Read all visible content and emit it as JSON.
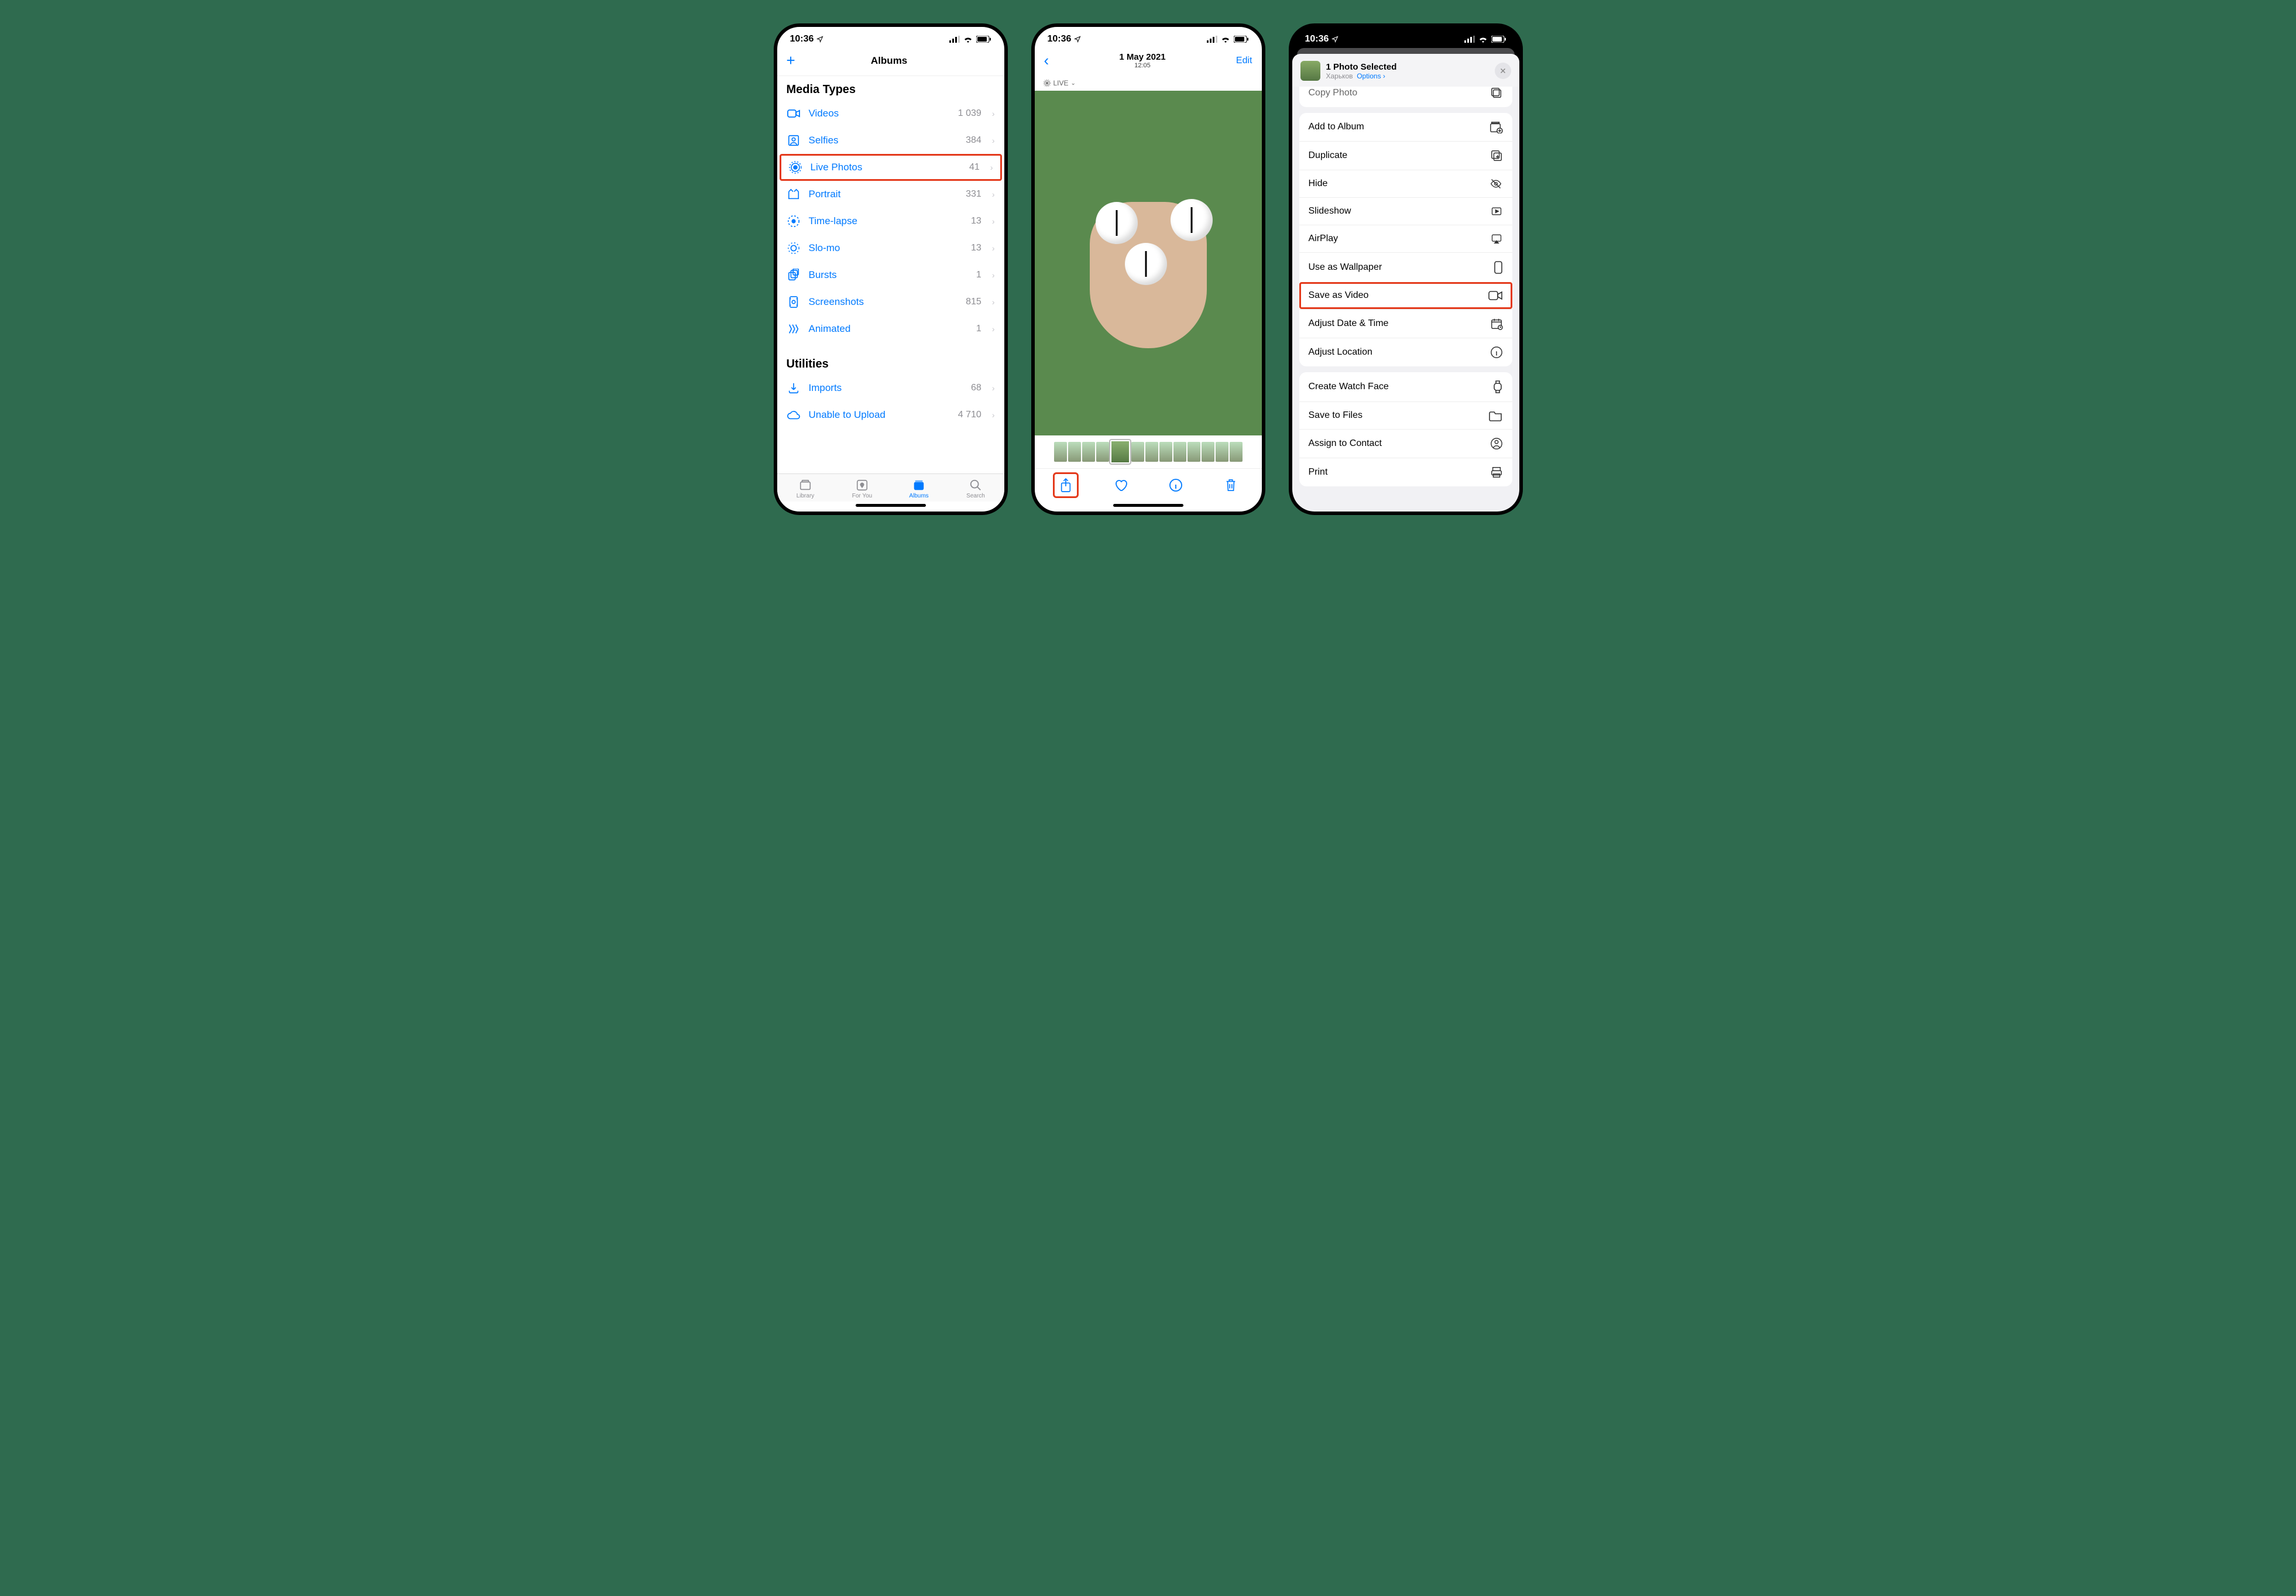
{
  "status": {
    "time": "10:36"
  },
  "screen1": {
    "nav_title": "Albums",
    "sections": {
      "media_types": {
        "title": "Media Types",
        "items": [
          {
            "label": "Videos",
            "count": "1 039",
            "icon": "video"
          },
          {
            "label": "Selfies",
            "count": "384",
            "icon": "selfie"
          },
          {
            "label": "Live Photos",
            "count": "41",
            "icon": "live",
            "highlighted": true
          },
          {
            "label": "Portrait",
            "count": "331",
            "icon": "portrait"
          },
          {
            "label": "Time-lapse",
            "count": "13",
            "icon": "timelapse"
          },
          {
            "label": "Slo-mo",
            "count": "13",
            "icon": "slomo"
          },
          {
            "label": "Bursts",
            "count": "1",
            "icon": "bursts"
          },
          {
            "label": "Screenshots",
            "count": "815",
            "icon": "screenshots"
          },
          {
            "label": "Animated",
            "count": "1",
            "icon": "animated"
          }
        ]
      },
      "utilities": {
        "title": "Utilities",
        "items": [
          {
            "label": "Imports",
            "count": "68",
            "icon": "imports"
          },
          {
            "label": "Unable to Upload",
            "count": "4 710",
            "icon": "cloud"
          }
        ]
      }
    },
    "tabs": [
      {
        "label": "Library",
        "icon": "library"
      },
      {
        "label": "For You",
        "icon": "foryou"
      },
      {
        "label": "Albums",
        "icon": "albums",
        "active": true
      },
      {
        "label": "Search",
        "icon": "search"
      }
    ]
  },
  "screen2": {
    "date": "1 May 2021",
    "time": "12:05",
    "edit_label": "Edit",
    "live_label": "LIVE"
  },
  "screen3": {
    "header": {
      "title": "1 Photo Selected",
      "location": "Харьков",
      "options_label": "Options"
    },
    "cut_action": {
      "label": "Copy Photo"
    },
    "group1": [
      {
        "label": "Add to Album",
        "icon": "addalbum"
      },
      {
        "label": "Duplicate",
        "icon": "duplicate"
      },
      {
        "label": "Hide",
        "icon": "hide"
      },
      {
        "label": "Slideshow",
        "icon": "slideshow"
      },
      {
        "label": "AirPlay",
        "icon": "airplay"
      },
      {
        "label": "Use as Wallpaper",
        "icon": "wallpaper"
      },
      {
        "label": "Save as Video",
        "icon": "savevideo",
        "highlighted": true
      },
      {
        "label": "Adjust Date & Time",
        "icon": "adjustdate"
      },
      {
        "label": "Adjust Location",
        "icon": "adjustloc"
      }
    ],
    "group2": [
      {
        "label": "Create Watch Face",
        "icon": "watch"
      },
      {
        "label": "Save to Files",
        "icon": "folder"
      },
      {
        "label": "Assign to Contact",
        "icon": "contact"
      },
      {
        "label": "Print",
        "icon": "print"
      }
    ]
  }
}
